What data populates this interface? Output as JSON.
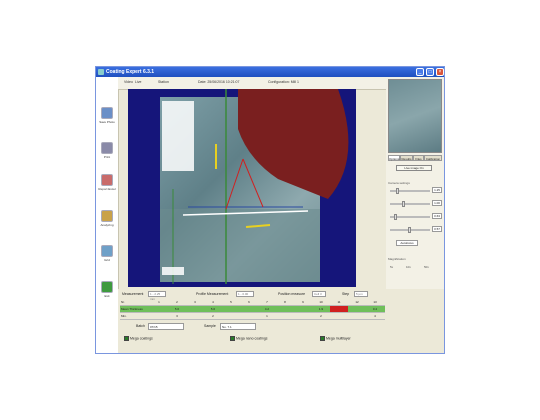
{
  "window": {
    "title": "Coating Expert  6.3.1"
  },
  "sidebar": {
    "items": [
      {
        "label": "Save Photo",
        "icon": "save-photo-icon",
        "color": "#6b8fc7"
      },
      {
        "label": "Print",
        "icon": "printer-icon",
        "color": "#8a8aa8"
      },
      {
        "label": "Report Excel",
        "icon": "report-icon",
        "color": "#c96b6b"
      },
      {
        "label": "Analyzing",
        "icon": "analyzing-icon",
        "color": "#c9a24a"
      },
      {
        "label": "Grid",
        "icon": "grid-icon",
        "color": "#6fa0c8"
      },
      {
        "label": "Exit",
        "icon": "exit-icon",
        "color": "#3f9a3f"
      }
    ]
  },
  "topbar": {
    "tabs": [
      "Video",
      "Live",
      "Station",
      "Date: 25/06/2016 10:21:07",
      "Configuration: Mill 1"
    ]
  },
  "right_panel": {
    "tabs": [
      "Options",
      "Results",
      "Files",
      "Calibration"
    ],
    "action_button": "Live image On",
    "section_image": "Live/Freeze",
    "section_sliders": "Camera settings",
    "slider_values": [
      "1.25",
      "1.00",
      "0.63",
      "0.57"
    ],
    "slider_tag": "Autofocus",
    "section_focus": "Magnification",
    "focus_options": [
      "5x",
      "10x",
      "50x"
    ]
  },
  "controls": {
    "measurement_label": "Measurement",
    "measurement_value": "1 - 2.25 mm",
    "profile_label": "Profile Measurement",
    "profile_value": "1 - 0.00",
    "position_label": "Position measure",
    "position_value": "Cell 3",
    "step_label": "Step",
    "step_value": "5 µm"
  },
  "grid": {
    "rows": [
      {
        "name": "Nr.",
        "cells": [
          "",
          "1",
          "2",
          "3",
          "4",
          "5",
          "6",
          "7",
          "8",
          "9",
          "10",
          "11",
          "12",
          "13"
        ]
      },
      {
        "name": "Mean Thickness",
        "cells": [
          "",
          "",
          "5.6",
          "",
          "5.6",
          "",
          "",
          "4.2",
          "",
          "",
          "1.9",
          "",
          "",
          "0.4"
        ]
      },
      {
        "name": "Min.",
        "cells": [
          "",
          "",
          "3",
          "",
          "2",
          "",
          "",
          "1",
          "",
          "",
          "2",
          "",
          "",
          "4"
        ]
      }
    ]
  },
  "fields": {
    "batch_label": "Batch",
    "batch_value": "07/15",
    "sample_label": "Sample",
    "sample_value": "No. 7.1"
  },
  "checks": [
    {
      "label": "Mega coatings",
      "checked": true
    },
    {
      "label": "Mega nano coatings",
      "checked": true
    },
    {
      "label": "Mega multilayer",
      "checked": true
    }
  ]
}
